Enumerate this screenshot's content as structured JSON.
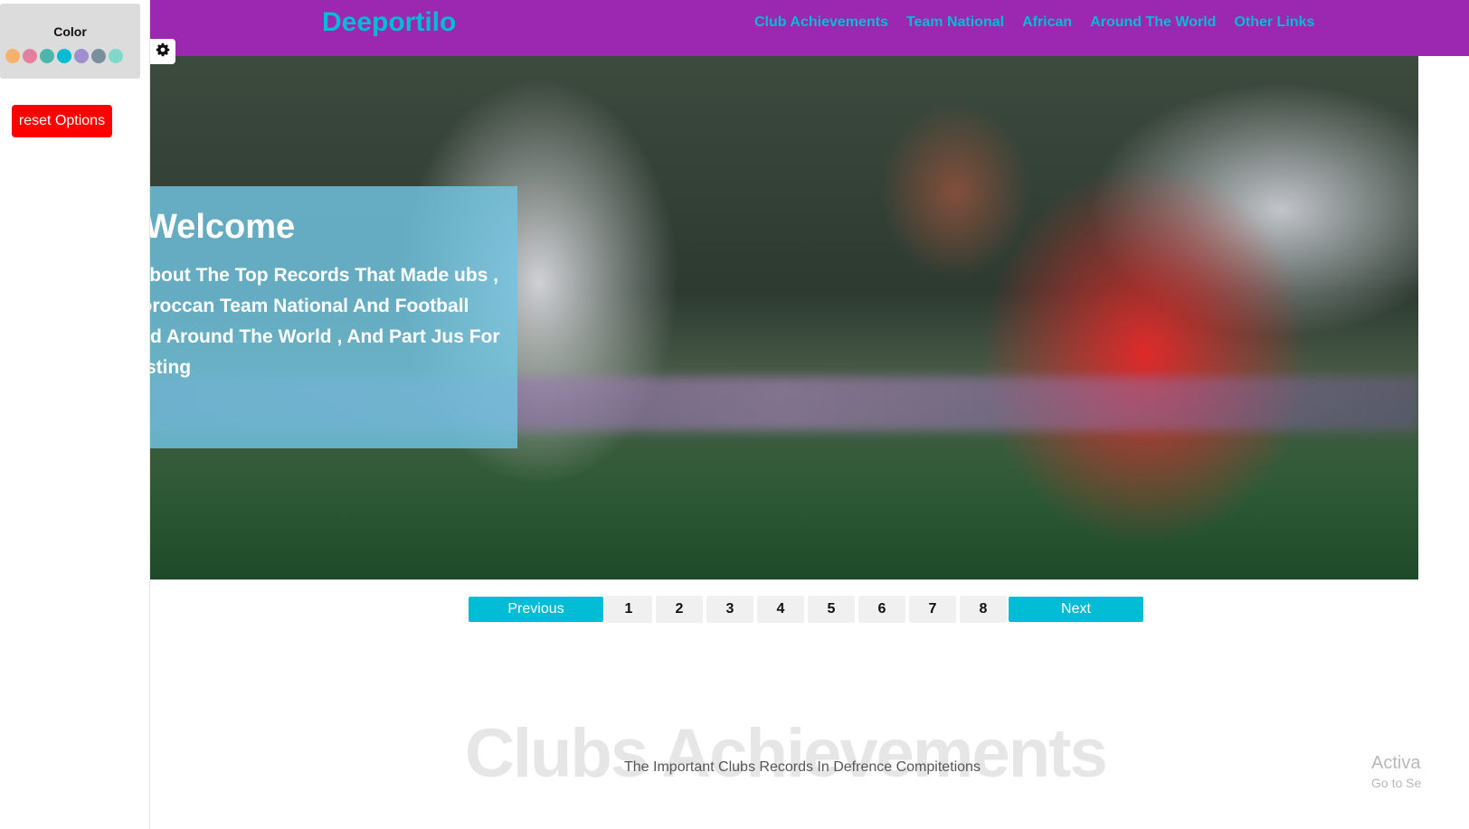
{
  "options": {
    "color_title": "Color",
    "swatches": [
      "#f4b26a",
      "#e57fa0",
      "#4db6ac",
      "#00bcd4",
      "#9e8fcf",
      "#78909c",
      "#80d8c8"
    ],
    "reset_label": "reset Options",
    "gear_icon": "gear-icon"
  },
  "header": {
    "logo": "Deeportilo",
    "nav": [
      "Club Achievements",
      "Team National",
      "African",
      "Around The World",
      "Other Links"
    ],
    "background_color": "#9c27b0",
    "accent_color": "#00bcd4"
  },
  "hero": {
    "title": "Welcome",
    "text": "t About The Top Records That Made ubs , Moroccan Team National And Football And Around The World , And Part Jus For Testing"
  },
  "pagination": {
    "previous": "Previous",
    "pages": [
      "1",
      "2",
      "3",
      "4",
      "5",
      "6",
      "7",
      "8"
    ],
    "next": "Next"
  },
  "section": {
    "background_title": "Clubs Achievements",
    "subtitle": "The Important Clubs Records In Defrence Compitetions"
  },
  "watermark": {
    "line1": "Activa",
    "line2": "Go to Se"
  }
}
